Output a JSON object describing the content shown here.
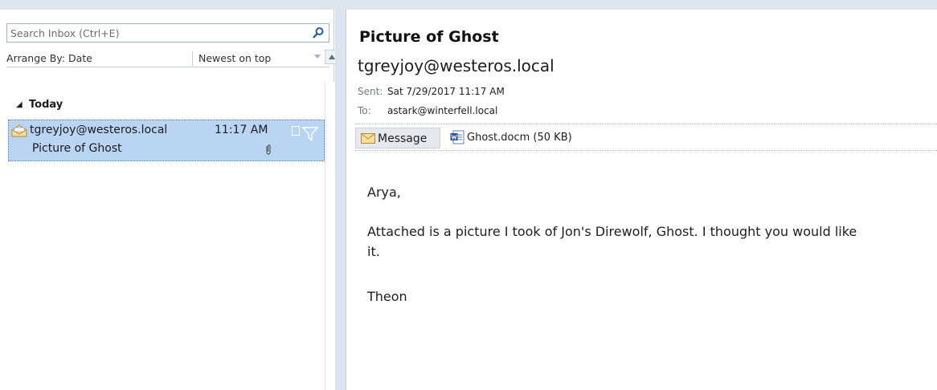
{
  "search": {
    "placeholder": "Search Inbox (Ctrl+E)"
  },
  "arrange": {
    "label": "Arrange By: Date",
    "order": "Newest on top"
  },
  "group": {
    "label": "Today"
  },
  "mail_list": [
    {
      "from": "tgreyjoy@westeros.local",
      "time": "11:17 AM",
      "subject": "Picture of Ghost"
    }
  ],
  "reading": {
    "subject": "Picture of Ghost",
    "from": "tgreyjoy@westeros.local",
    "sent_label": "Sent:",
    "sent_value": "Sat 7/29/2017 11:17 AM",
    "to_label": "To:",
    "to_value": "astark@winterfell.local",
    "message_tab": "Message",
    "attachment": "Ghost.docm (50 KB)",
    "body": [
      "Arya,",
      "Attached is a picture I took of Jon's Direwolf, Ghost.  I thought you would like",
      "it.",
      "Theon"
    ]
  },
  "colors": {
    "selected_item": "#b9d5f3",
    "frame": "#dde4ee",
    "accent": "#1f5fa8"
  }
}
